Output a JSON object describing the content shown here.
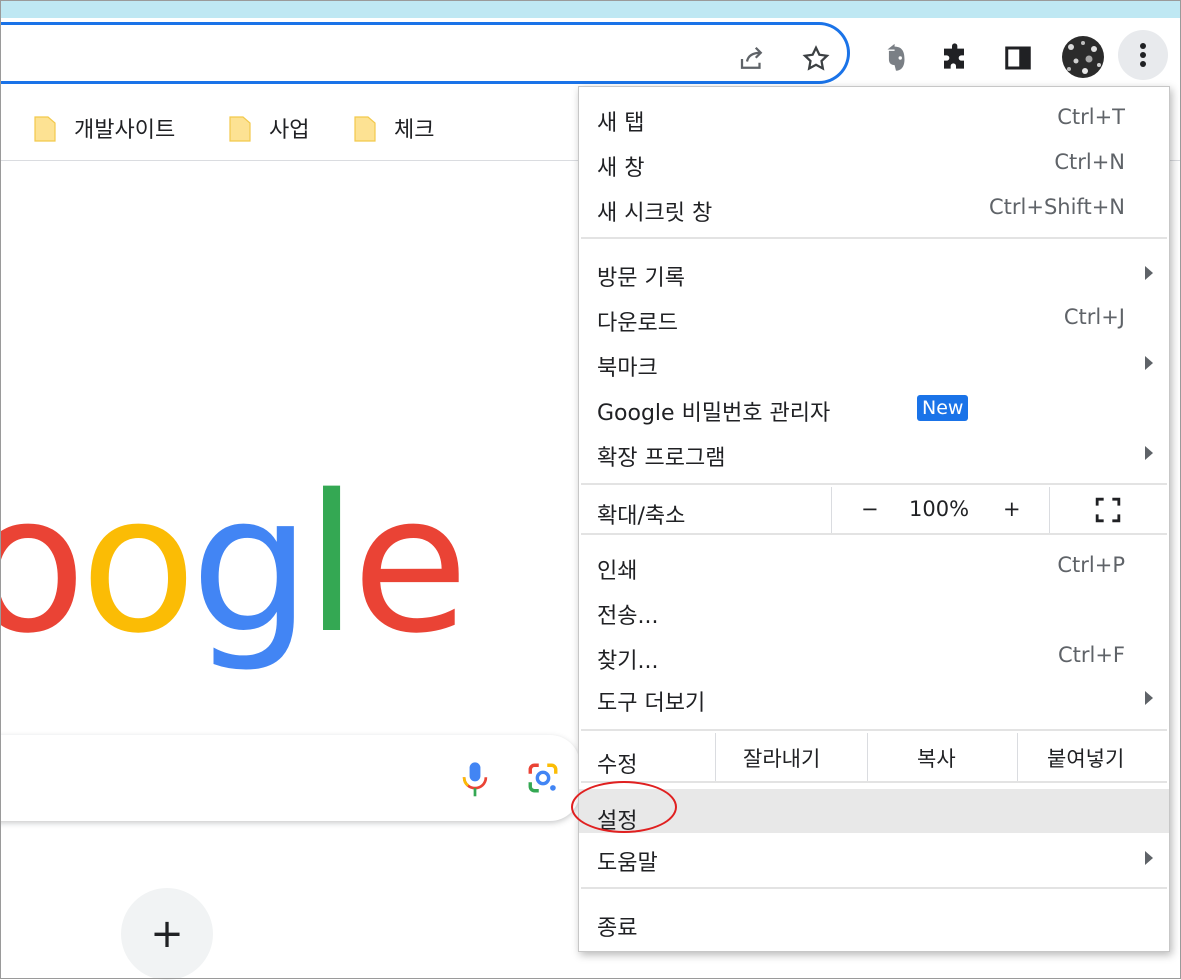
{
  "bookmarks": [
    {
      "label": "개발사이트"
    },
    {
      "label": "사업"
    },
    {
      "label": "체크"
    }
  ],
  "logo": {
    "letters": [
      "o",
      "o",
      "g",
      "l",
      "e"
    ],
    "colors": [
      "#ea4335",
      "#fbbc05",
      "#4285f4",
      "#34a853",
      "#ea4335"
    ]
  },
  "colors": {
    "accent": "#1a73e8",
    "highlight_circle": "#e02020",
    "menu_hover": "#e8e8e8"
  },
  "new_tab_plus": "+",
  "menu": {
    "new_tab": {
      "label": "새 탭",
      "shortcut": "Ctrl+T"
    },
    "new_window": {
      "label": "새 창",
      "shortcut": "Ctrl+N"
    },
    "incognito": {
      "label": "새 시크릿 창",
      "shortcut": "Ctrl+Shift+N"
    },
    "history": {
      "label": "방문 기록"
    },
    "downloads": {
      "label": "다운로드",
      "shortcut": "Ctrl+J"
    },
    "bookmarks": {
      "label": "북마크"
    },
    "password_manager": {
      "label": "Google 비밀번호 관리자",
      "badge": "New"
    },
    "extensions": {
      "label": "확장 프로그램"
    },
    "zoom": {
      "label": "확대/축소",
      "minus": "−",
      "value": "100%",
      "plus": "+"
    },
    "print": {
      "label": "인쇄",
      "shortcut": "Ctrl+P"
    },
    "cast": {
      "label": "전송..."
    },
    "find": {
      "label": "찾기...",
      "shortcut": "Ctrl+F"
    },
    "more_tools": {
      "label": "도구 더보기"
    },
    "edit": {
      "label": "수정",
      "cut": "잘라내기",
      "copy": "복사",
      "paste": "붙여넣기"
    },
    "settings": {
      "label": "설정"
    },
    "help": {
      "label": "도움말"
    },
    "exit": {
      "label": "종료"
    }
  }
}
